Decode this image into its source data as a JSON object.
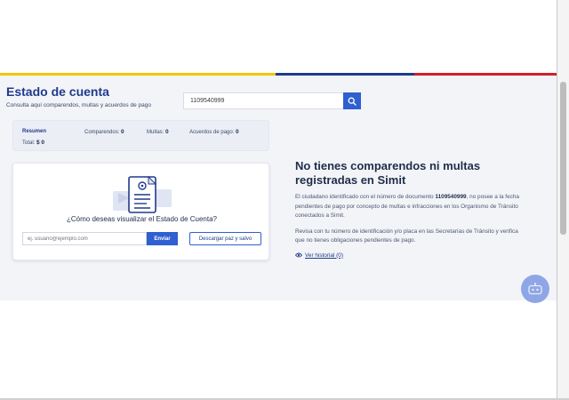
{
  "header": {
    "title": "Estado de cuenta",
    "subtitle": "Consulta aquí comparendos, multas y acuerdos de pago",
    "search_value": "1109540999"
  },
  "summary": {
    "resumen_label": "Resumen",
    "comparendos_label": "Comparendos:",
    "comparendos_value": "0",
    "multas_label": "Multas:",
    "multas_value": "0",
    "acuerdos_label": "Acuerdos de pago:",
    "acuerdos_value": "0",
    "total_label": "Total:",
    "total_value": "$ 0"
  },
  "card": {
    "question": "¿Cómo deseas visualizar el Estado de Cuenta?",
    "email_placeholder": "ej. usuario@ejemplo.com",
    "send_label": "Enviar",
    "download_label": "Descargar paz y salvo"
  },
  "result": {
    "heading": "No tienes comparendos ni multas registradas en Simit",
    "p1_before": "El ciudadano identificado con el número de documento ",
    "p1_doc": "1109540999",
    "p1_after": ", no posee a la fecha pendientes de pago por concepto de multas e infracciones en los Organismo de Tránsito conectados a Simit.",
    "p2": "Revisa con tu número de identificación y/o placa en las Secretarías de Tránsito y verifica que no tienes obligaciones pendientes de pago.",
    "history_link": "Ver historial (0)"
  },
  "colors": {
    "primary": "#1f3a8c",
    "button": "#2f5fd0",
    "flag_yellow": "#f5c400",
    "flag_blue": "#1f3a8c",
    "flag_red": "#d21f2b"
  },
  "icons": {
    "search": "search-icon",
    "document": "document-illustration",
    "history": "eye-icon",
    "help": "chat-bot-icon"
  }
}
